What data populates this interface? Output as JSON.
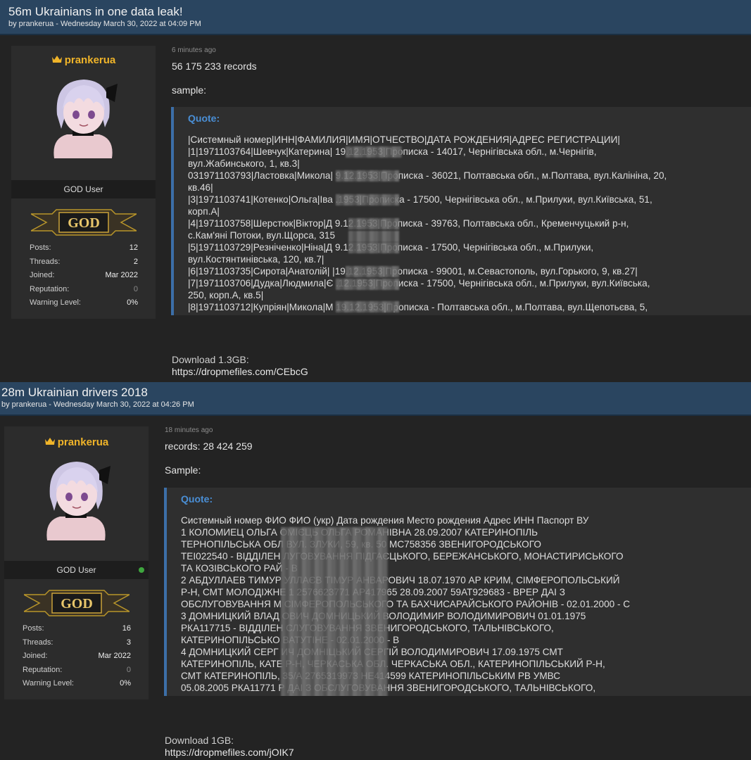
{
  "posts": [
    {
      "title": "56m Ukrainians in one data leak!",
      "byline": "by prankerua - Wednesday March 30, 2022 at 04:09 PM",
      "username": "prankerua",
      "rank": "GOD User",
      "badge": "GOD",
      "stats": [
        {
          "label": "Posts:",
          "value": "12"
        },
        {
          "label": "Threads:",
          "value": "2"
        },
        {
          "label": "Joined:",
          "value": "Mar 2022"
        },
        {
          "label": "Reputation:",
          "value": "0"
        },
        {
          "label": "Warning Level:",
          "value": "0%"
        }
      ],
      "time": "6 minutes ago",
      "line1": "56 175 233 records",
      "line2": "sample:",
      "quote_label": "Quote:",
      "quote_lines": [
        "|Системный номер|ИНН|ФАМИЛИЯ|ИМЯ|ОТЧЕСТВО|ДАТА РОЖДЕНИЯ|АДРЕС РЕГИСТРАЦИИ|",
        "|1|1971103764|Шевчук|Катерина|              19.12.1953|Прописка - 14017, Чернігівська обл., м.Чернігів,",
        "вул.Жабинського, 1, кв.3|",
        "031971103793|Ластовка|Микола|              9.12.1953|Прописка - 36021, Полтавська обл., м.Полтава, вул.Калініна, 20,",
        "кв.46|",
        "|3|1971103741|Котенко|Ольга|Іва              .1953|Прописка - 17500, Чернігівська обл., м.Прилуки, вул.Київська, 51,",
        "корп.А|",
        "|4|1971103758|Шерстюк|Віктор|Д              9.12.1953|Прописка - 39763, Полтавська обл., Кременчуцький р-н,",
        "с.Кам'яні Потоки, вул.Щорса, 315",
        "|5|1971103729|Резніченко|Ніна|Д              9.12.1953|Прописка - 17500, Чернігівська обл., м.Прилуки,",
        "вул.Костянтинівська, 120, кв.7|",
        "|6|1971103735|Сирота|Анатолій|              |19.12.1953|Прописка - 99001, м.Севастополь, вул.Горького, 9, кв.27|",
        "|7|1971103706|Дудка|Людмила|Є              .12.1953|Прописка - 17500, Чернігівська обл., м.Прилуки, вул.Київська,",
        "250, корп.А, кв.5|",
        "|8|1971103712|Купріян|Микола|М              19.12.1953|Прописка - Полтавська обл., м.Полтава, вул.Щепотьєва, 5,"
      ],
      "download": "Download 1.3GB:",
      "link": "https://dropmefiles.com/CEbcG"
    },
    {
      "title": "28m Ukrainian drivers 2018",
      "byline": "by prankerua - Wednesday March 30, 2022 at 04:26 PM",
      "username": "prankerua",
      "rank": "GOD User",
      "badge": "GOD",
      "stats": [
        {
          "label": "Posts:",
          "value": "16"
        },
        {
          "label": "Threads:",
          "value": "3"
        },
        {
          "label": "Joined:",
          "value": "Mar 2022"
        },
        {
          "label": "Reputation:",
          "value": "0"
        },
        {
          "label": "Warning Level:",
          "value": "0%"
        }
      ],
      "time": "18 minutes ago",
      "line1": "records: 28 424 259",
      "line2": "Sample:",
      "quote_label": "Quote:",
      "quote_lines": [
        "Системный номер ФИО ФИО (укр) Дата рождения Место рождения Адрес ИНН Паспорт ВУ",
        "1 КОЛОМИЕЦ ОЛЬГА                   ОМІЄЦЬ ОЛЬГА РОМАНІВНА 28.09.2007 КАТЕРИНОПІЛЬ",
        "ТЕРНОПІЛЬСЬКА ОБЛ                  ВУЛ. ЗЛУКИ, 59, кв. 50 МС758356 ЗВЕНИГОРОДСЬКОГО",
        "ТЕІ022540 - ВІДДІЛЕН               ЛУГОВУВАННЯ ПІДГАЄЦЬКОГО, БЕРЕЖАНСЬКОГО, МОНАСТИРИСЬКОГО",
        "ТА КОЗІВСЬКОГО РАЙ                 - В",
        "2 АБДУЛЛАЕВ ТИМУР                  УЛЛАЄВ ТІМУР АНВАРОВИЧ 18.07.1970 АР КРИМ, СІМФЕРОПОЛЬСЬКИЙ",
        "Р-Н, СМТ МОЛОДІЖНЕ                 1 2576623771 АР417965 28.09.2007 59АТ929683 - ВРЕР ДАІ З",
        "ОБСЛУГОВУВАННЯ М                   СІМФЕРОПОЛЬСЬКОГО ТА БАХЧИСАРАЙСЬКОГО РАЙОНІВ - 02.01.2000 - С",
        "3 ДОМНИЦКИЙ ВЛАД                   ОВИЧ ДОМНИЦЬКИЙ ВОЛОДИМИР ВОЛОДИМИРОВИЧ 01.01.1975",
        "РКА117715 - ВІДДІЛЕН               СЛУГОВУВАННЯ ЗВЕНИГОРОДСЬКОГО, ТАЛЬНІВСЬКОГО,",
        "КАТЕРИНОПІЛЬСЬКО                   ВАТУТІНЕ  - 02.01.2000 - В",
        "4 ДОМНИЦКИЙ СЕРГ                   ИЧ ДОМНІЦЬКИЙ СЕРГІЙ ВОЛОДИМИРОВИЧ 17.09.1975 СМТ",
        "КАТЕРИНОПІЛЬ, КАТЕ                 Р-Н, ЧЕРКАСЬКА ОБЛ. ЧЕРКАСЬКА ОБЛ., КАТЕРИНОПІЛЬСЬКИЙ  Р-Н,",
        "СМТ КАТЕРИНОПІЛЬ,                  35/А 2765319973 НЕ414599 КАТЕРИНОПІЛЬСЬКИМ РВ УМВС",
        "05.08.2005 РКА11771                Р ДАІ З ОБСЛУГОВУВАННЯ ЗВЕНИГОРОДСЬКОГО, ТАЛЬНІВСЬКОГО,"
      ],
      "download": "Download 1GB:",
      "link": "https://dropmefiles.com/jOIK7"
    }
  ]
}
